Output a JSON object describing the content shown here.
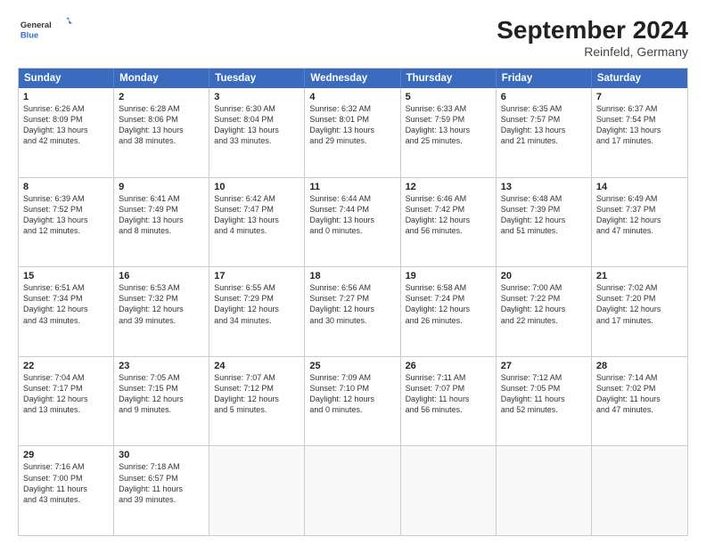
{
  "header": {
    "logo_general": "General",
    "logo_blue": "Blue",
    "title": "September 2024",
    "subtitle": "Reinfeld, Germany"
  },
  "days": [
    "Sunday",
    "Monday",
    "Tuesday",
    "Wednesday",
    "Thursday",
    "Friday",
    "Saturday"
  ],
  "weeks": [
    [
      {
        "day": "1",
        "lines": [
          "Sunrise: 6:26 AM",
          "Sunset: 8:09 PM",
          "Daylight: 13 hours",
          "and 42 minutes."
        ]
      },
      {
        "day": "2",
        "lines": [
          "Sunrise: 6:28 AM",
          "Sunset: 8:06 PM",
          "Daylight: 13 hours",
          "and 38 minutes."
        ]
      },
      {
        "day": "3",
        "lines": [
          "Sunrise: 6:30 AM",
          "Sunset: 8:04 PM",
          "Daylight: 13 hours",
          "and 33 minutes."
        ]
      },
      {
        "day": "4",
        "lines": [
          "Sunrise: 6:32 AM",
          "Sunset: 8:01 PM",
          "Daylight: 13 hours",
          "and 29 minutes."
        ]
      },
      {
        "day": "5",
        "lines": [
          "Sunrise: 6:33 AM",
          "Sunset: 7:59 PM",
          "Daylight: 13 hours",
          "and 25 minutes."
        ]
      },
      {
        "day": "6",
        "lines": [
          "Sunrise: 6:35 AM",
          "Sunset: 7:57 PM",
          "Daylight: 13 hours",
          "and 21 minutes."
        ]
      },
      {
        "day": "7",
        "lines": [
          "Sunrise: 6:37 AM",
          "Sunset: 7:54 PM",
          "Daylight: 13 hours",
          "and 17 minutes."
        ]
      }
    ],
    [
      {
        "day": "8",
        "lines": [
          "Sunrise: 6:39 AM",
          "Sunset: 7:52 PM",
          "Daylight: 13 hours",
          "and 12 minutes."
        ]
      },
      {
        "day": "9",
        "lines": [
          "Sunrise: 6:41 AM",
          "Sunset: 7:49 PM",
          "Daylight: 13 hours",
          "and 8 minutes."
        ]
      },
      {
        "day": "10",
        "lines": [
          "Sunrise: 6:42 AM",
          "Sunset: 7:47 PM",
          "Daylight: 13 hours",
          "and 4 minutes."
        ]
      },
      {
        "day": "11",
        "lines": [
          "Sunrise: 6:44 AM",
          "Sunset: 7:44 PM",
          "Daylight: 13 hours",
          "and 0 minutes."
        ]
      },
      {
        "day": "12",
        "lines": [
          "Sunrise: 6:46 AM",
          "Sunset: 7:42 PM",
          "Daylight: 12 hours",
          "and 56 minutes."
        ]
      },
      {
        "day": "13",
        "lines": [
          "Sunrise: 6:48 AM",
          "Sunset: 7:39 PM",
          "Daylight: 12 hours",
          "and 51 minutes."
        ]
      },
      {
        "day": "14",
        "lines": [
          "Sunrise: 6:49 AM",
          "Sunset: 7:37 PM",
          "Daylight: 12 hours",
          "and 47 minutes."
        ]
      }
    ],
    [
      {
        "day": "15",
        "lines": [
          "Sunrise: 6:51 AM",
          "Sunset: 7:34 PM",
          "Daylight: 12 hours",
          "and 43 minutes."
        ]
      },
      {
        "day": "16",
        "lines": [
          "Sunrise: 6:53 AM",
          "Sunset: 7:32 PM",
          "Daylight: 12 hours",
          "and 39 minutes."
        ]
      },
      {
        "day": "17",
        "lines": [
          "Sunrise: 6:55 AM",
          "Sunset: 7:29 PM",
          "Daylight: 12 hours",
          "and 34 minutes."
        ]
      },
      {
        "day": "18",
        "lines": [
          "Sunrise: 6:56 AM",
          "Sunset: 7:27 PM",
          "Daylight: 12 hours",
          "and 30 minutes."
        ]
      },
      {
        "day": "19",
        "lines": [
          "Sunrise: 6:58 AM",
          "Sunset: 7:24 PM",
          "Daylight: 12 hours",
          "and 26 minutes."
        ]
      },
      {
        "day": "20",
        "lines": [
          "Sunrise: 7:00 AM",
          "Sunset: 7:22 PM",
          "Daylight: 12 hours",
          "and 22 minutes."
        ]
      },
      {
        "day": "21",
        "lines": [
          "Sunrise: 7:02 AM",
          "Sunset: 7:20 PM",
          "Daylight: 12 hours",
          "and 17 minutes."
        ]
      }
    ],
    [
      {
        "day": "22",
        "lines": [
          "Sunrise: 7:04 AM",
          "Sunset: 7:17 PM",
          "Daylight: 12 hours",
          "and 13 minutes."
        ]
      },
      {
        "day": "23",
        "lines": [
          "Sunrise: 7:05 AM",
          "Sunset: 7:15 PM",
          "Daylight: 12 hours",
          "and 9 minutes."
        ]
      },
      {
        "day": "24",
        "lines": [
          "Sunrise: 7:07 AM",
          "Sunset: 7:12 PM",
          "Daylight: 12 hours",
          "and 5 minutes."
        ]
      },
      {
        "day": "25",
        "lines": [
          "Sunrise: 7:09 AM",
          "Sunset: 7:10 PM",
          "Daylight: 12 hours",
          "and 0 minutes."
        ]
      },
      {
        "day": "26",
        "lines": [
          "Sunrise: 7:11 AM",
          "Sunset: 7:07 PM",
          "Daylight: 11 hours",
          "and 56 minutes."
        ]
      },
      {
        "day": "27",
        "lines": [
          "Sunrise: 7:12 AM",
          "Sunset: 7:05 PM",
          "Daylight: 11 hours",
          "and 52 minutes."
        ]
      },
      {
        "day": "28",
        "lines": [
          "Sunrise: 7:14 AM",
          "Sunset: 7:02 PM",
          "Daylight: 11 hours",
          "and 47 minutes."
        ]
      }
    ],
    [
      {
        "day": "29",
        "lines": [
          "Sunrise: 7:16 AM",
          "Sunset: 7:00 PM",
          "Daylight: 11 hours",
          "and 43 minutes."
        ]
      },
      {
        "day": "30",
        "lines": [
          "Sunrise: 7:18 AM",
          "Sunset: 6:57 PM",
          "Daylight: 11 hours",
          "and 39 minutes."
        ]
      },
      {
        "day": "",
        "lines": []
      },
      {
        "day": "",
        "lines": []
      },
      {
        "day": "",
        "lines": []
      },
      {
        "day": "",
        "lines": []
      },
      {
        "day": "",
        "lines": []
      }
    ]
  ]
}
